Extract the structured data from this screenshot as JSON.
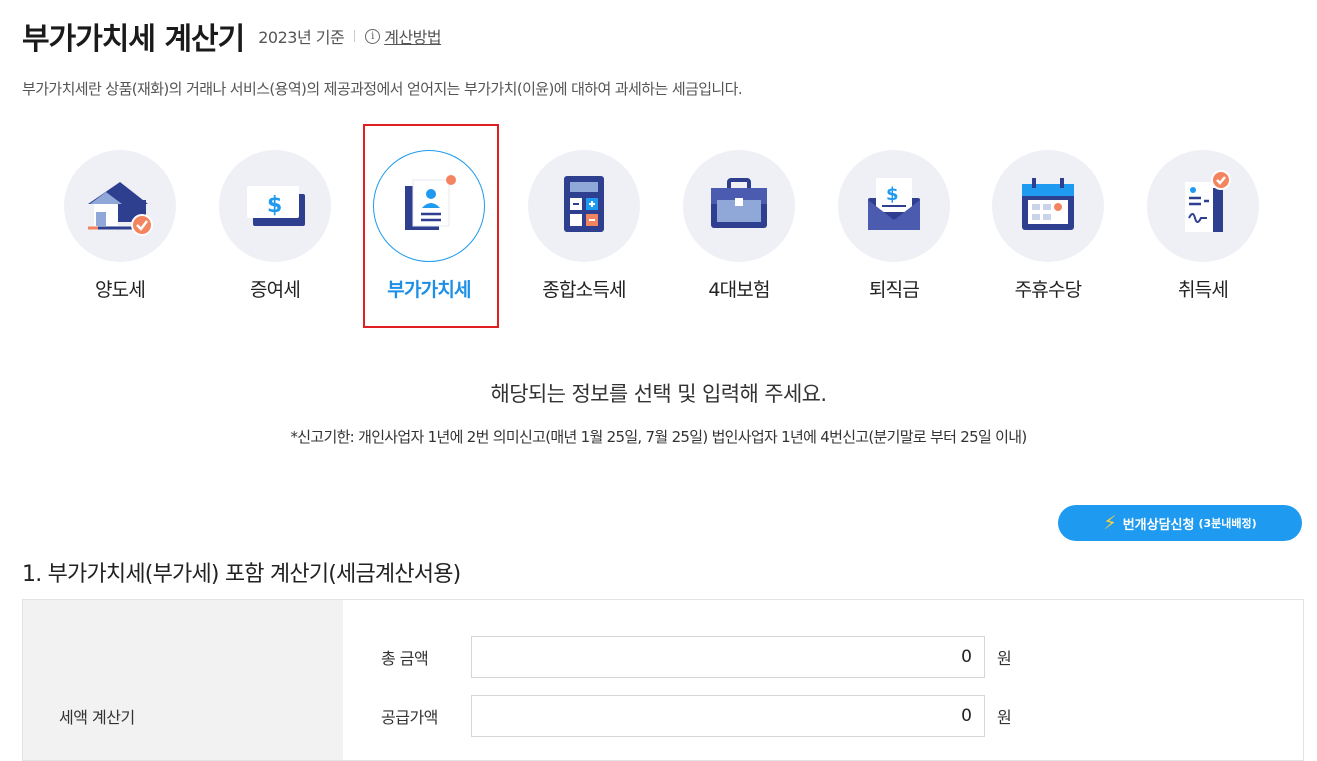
{
  "header": {
    "title": "부가가치세 계산기",
    "year": "2023년 기준",
    "howto": "계산방법",
    "info_glyph": "i"
  },
  "description": "부가가치세란 상품(재화)의 거래나 서비스(용역)의 제공과정에서 얻어지는 부가가치(이윤)에 대하여 과세하는 세금입니다.",
  "categories": [
    {
      "label": "양도세",
      "icon": "house-check-icon"
    },
    {
      "label": "증여세",
      "icon": "money-bill-icon"
    },
    {
      "label": "부가가치세",
      "icon": "document-profile-icon",
      "active": true
    },
    {
      "label": "종합소득세",
      "icon": "calculator-icon"
    },
    {
      "label": "4대보험",
      "icon": "briefcase-icon"
    },
    {
      "label": "퇴직금",
      "icon": "envelope-money-icon"
    },
    {
      "label": "주휴수당",
      "icon": "calendar-icon"
    },
    {
      "label": "취득세",
      "icon": "document-signature-icon"
    }
  ],
  "guide": {
    "main": "해당되는 정보를 선택 및 입력해 주세요.",
    "sub": "*신고기한: 개인사업자 1년에 2번 의미신고(매년 1월 25일, 7월 25일) 법인사업자 1년에 4번신고(분기말로 부터 25일 이내)"
  },
  "consult_button": {
    "label": "번개상담신청",
    "note": "(3분내배정)",
    "bolt": "⚡"
  },
  "section": {
    "title": "1. 부가가치세(부가세) 포함 계산기(세금계산서용)",
    "side_label": "세액 계산기",
    "rows": [
      {
        "label": "총 금액",
        "value": "0",
        "unit": "원"
      },
      {
        "label": "공급가액",
        "value": "0",
        "unit": "원"
      }
    ]
  },
  "colors": {
    "accent": "#1e9af0",
    "icon_circle": "#eef0f6",
    "icon_navy": "#2f3f8f",
    "badge_orange": "#f4845f",
    "highlight_red": "#e02020"
  }
}
